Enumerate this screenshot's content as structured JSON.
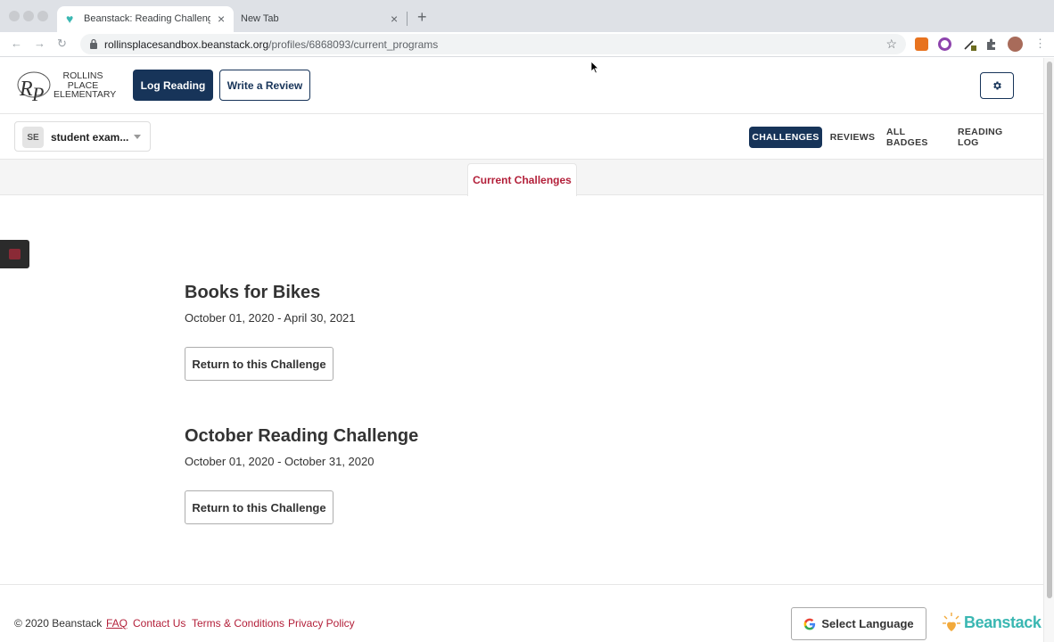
{
  "browser": {
    "tabs": [
      {
        "title": "Beanstack: Reading Challenge",
        "active": true
      },
      {
        "title": "New Tab",
        "active": false
      }
    ],
    "url_host": "rollinsplacesandbox.beanstack.org",
    "url_path": "/profiles/6868093/current_programs"
  },
  "header": {
    "logo_lines": [
      "ROLLINS",
      "PLACE",
      "ELEMENTARY"
    ],
    "logo_monogram": "RP",
    "log_reading": "Log Reading",
    "write_review": "Write a Review"
  },
  "profile": {
    "initials": "SE",
    "name": "student exam..."
  },
  "profile_nav": [
    "CHALLENGES",
    "REVIEWS",
    "ALL BADGES",
    "READING LOG"
  ],
  "tabs": {
    "current": "Current Challenges"
  },
  "challenges": [
    {
      "title": "Books for Bikes",
      "dates": "October 01, 2020 - April 30, 2021",
      "button": "Return to this Challenge"
    },
    {
      "title": "October Reading Challenge",
      "dates": "October 01, 2020 - October 31, 2020",
      "button": "Return to this Challenge"
    }
  ],
  "footer": {
    "copyright": "© 2020 Beanstack",
    "links": [
      "FAQ",
      "Contact Us",
      "Terms & Conditions",
      "Privacy Policy"
    ],
    "language_button": "Select Language",
    "brand": "Beanstack"
  },
  "colors": {
    "navy": "#173459",
    "accent_red": "#b3203a",
    "teal": "#3ab7b2"
  }
}
